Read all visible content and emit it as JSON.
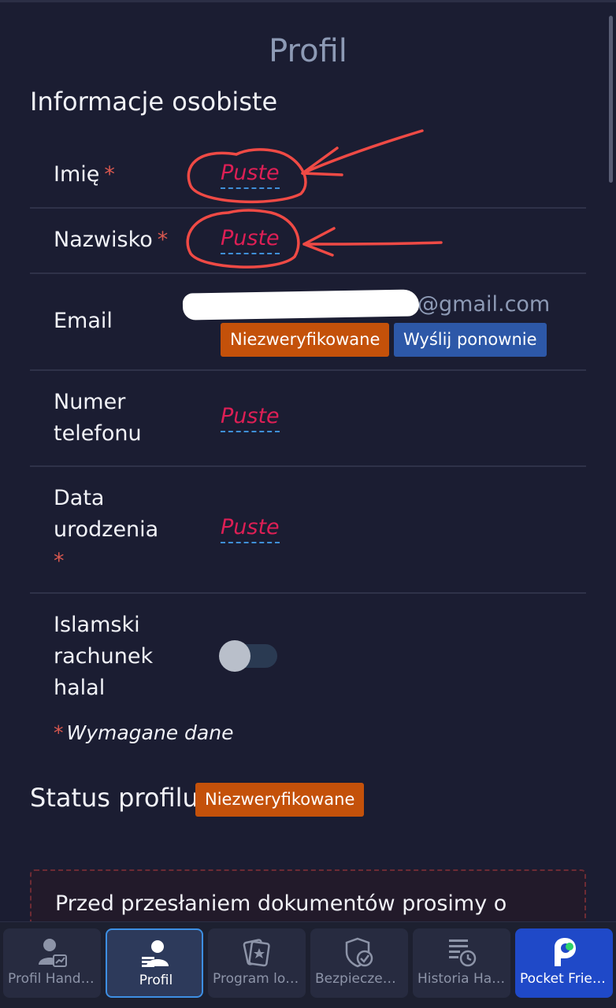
{
  "page": {
    "title": "Profil"
  },
  "personal": {
    "section_title": "Informacje osobiste",
    "first_name": {
      "label": "Imię",
      "required": "*",
      "value": "Puste"
    },
    "last_name": {
      "label": "Nazwisko",
      "required": "*",
      "value": "Puste"
    },
    "email": {
      "label": "Email",
      "value": "@gmail.com",
      "status_badge": "Niezweryfikowane",
      "resend_button": "Wyślij ponownie"
    },
    "phone": {
      "label_line1": "Numer",
      "label_line2": "telefonu",
      "value": "Puste"
    },
    "birth_date": {
      "label_line1": "Data",
      "label_line2": "urodzenia",
      "required": "*",
      "value": "Puste"
    },
    "islamic_account": {
      "label_line1": "Islamski",
      "label_line2": "rachunek",
      "label_line3": "halal",
      "enabled": false
    },
    "required_note": {
      "star": "*",
      "text": "Wymagane dane"
    }
  },
  "profile_status": {
    "title": "Status profilu",
    "badge": "Niezweryfikowane"
  },
  "notice": {
    "text": "Przed przesłaniem dokumentów prosimy o"
  },
  "bottom_nav": {
    "items": [
      {
        "label": "Profil Handlowca",
        "icon": "trader-profile-icon"
      },
      {
        "label": "Profil",
        "icon": "profile-icon",
        "active": true
      },
      {
        "label": "Program lojalnościowy",
        "icon": "loyalty-cards-icon"
      },
      {
        "label": "Bezpieczeństwo",
        "icon": "shield-icon"
      },
      {
        "label": "Historia Handlu",
        "icon": "history-icon"
      },
      {
        "label": "Pocket Friends",
        "icon": "pocket-friends-icon"
      }
    ]
  },
  "colors": {
    "background": "#1b1d32",
    "empty_value": "#dd1f55",
    "badge_orange": "#c4510a",
    "badge_blue": "#2d58a8",
    "annotation_red": "#ef4a45"
  }
}
